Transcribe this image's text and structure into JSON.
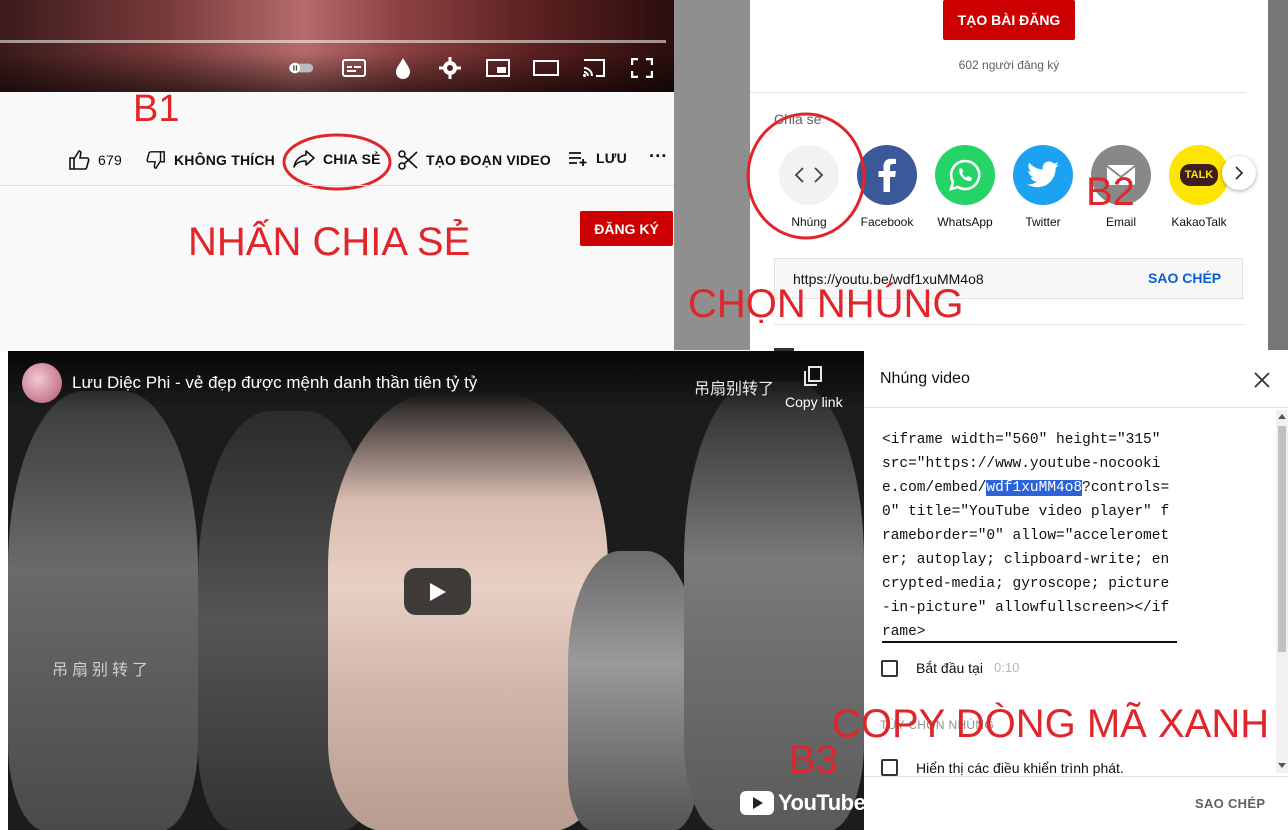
{
  "panel1": {
    "step_label": "B1",
    "likes": "679",
    "dislike_label": "KHÔNG THÍCH",
    "share_label": "CHIA SẺ",
    "clip_label": "TẠO ĐOẠN VIDEO",
    "save_label": "LƯU",
    "more_label": "···",
    "subscribe_label": "ĐĂNG KÝ",
    "instruction": "NHẤN CHIA SẺ"
  },
  "panel2": {
    "create_post_label": "TẠO BÀI ĐĂNG",
    "subscriber_count": "602 người đăng ký",
    "share_heading": "Chia sẻ",
    "targets": [
      {
        "label": "Nhúng",
        "icon": "embed-icon",
        "color": "#f2f2f2"
      },
      {
        "label": "Facebook",
        "icon": "facebook-icon",
        "color": "#3b5998"
      },
      {
        "label": "WhatsApp",
        "icon": "whatsapp-icon",
        "color": "#25d366"
      },
      {
        "label": "Twitter",
        "icon": "twitter-icon",
        "color": "#1da1f2"
      },
      {
        "label": "Email",
        "icon": "email-icon",
        "color": "#888888"
      },
      {
        "label": "KakaoTalk",
        "icon": "kakaotalk-icon",
        "color": "#fee500"
      }
    ],
    "kakao_badge": "TALK",
    "step_label": "B2",
    "url": "https://youtu.be/wdf1xuMM4o8",
    "copy_label": "SAO CHÉP",
    "instruction": "CHỌN NHÚNG"
  },
  "player": {
    "title": "Lưu Diệc Phi - vẻ đẹp được mệnh danh thần tiên tỷ tỷ",
    "copy_link_label": "Copy link",
    "watermark_top": "吊扇别转了",
    "watermark_left": "吊扇别转了",
    "youtube_logo_text": "YouTube",
    "step_label": "B3"
  },
  "embed": {
    "title": "Nhúng video",
    "code_before": "<iframe width=\"560\" height=\"315\" src=\"https://www.youtube-nocookie.com/embed/",
    "code_highlight": "wdf1xuMM4o8",
    "code_after": "?controls=0\" title=\"YouTube video player\" frameborder=\"0\" allow=\"accelerometer; autoplay; clipboard-write; encrypted-media; gyroscope; picture-in-picture\" allowfullscreen></iframe>",
    "start_at_label": "Bắt đầu tại",
    "start_at_time": "0:10",
    "options_heading": "TÙY CHỌN NHÚNG",
    "show_controls_label": "Hiển thị các điều khiển trình phát.",
    "copy_label": "SAO CHÉP",
    "instruction": "COPY DÒNG MÃ XANH"
  },
  "colors": {
    "annotation_red": "#e0252b",
    "youtube_red": "#cc0000",
    "link_blue": "#065fd4",
    "highlight_blue": "#2b63d9"
  }
}
